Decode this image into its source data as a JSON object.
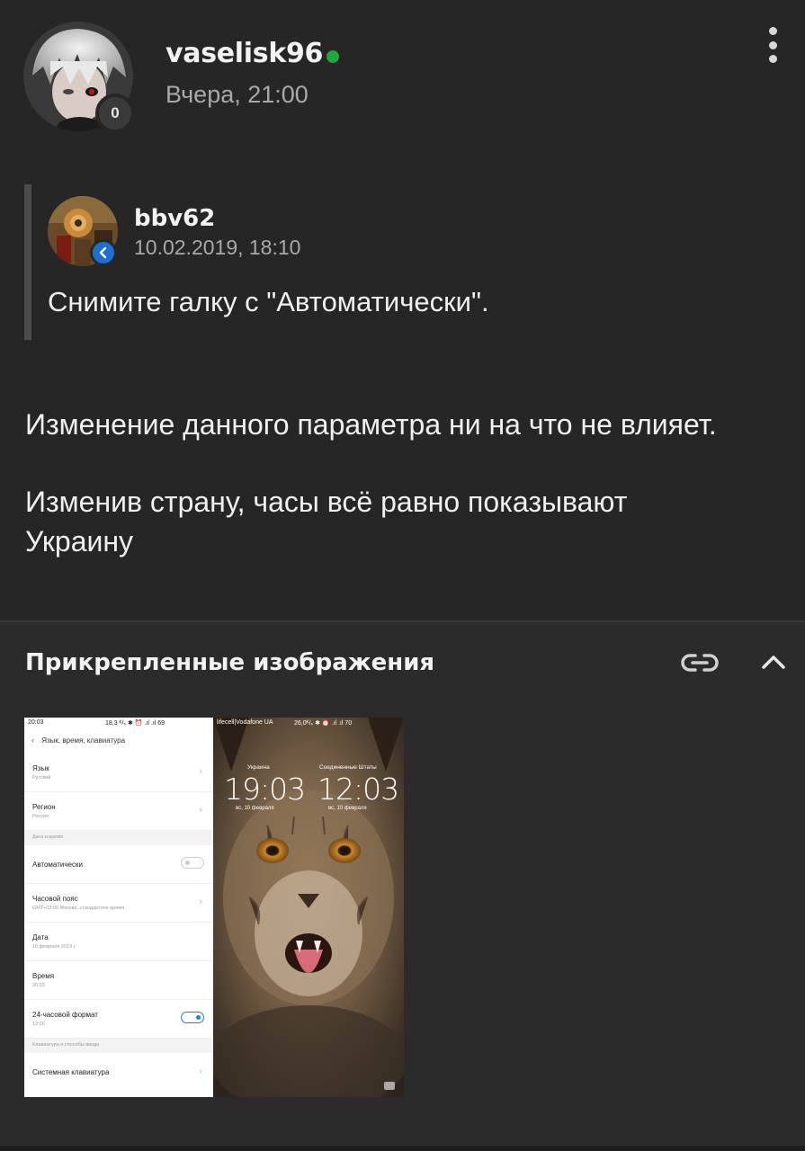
{
  "author": {
    "username": "vaselisk96",
    "reputation": "0",
    "date": "Вчера, 21:00",
    "online_color": "#1fa83a"
  },
  "quote": {
    "author": "bbv62",
    "date": "10.02.2019, 18:10",
    "text": "Снимите галку с \"Автоматически\"."
  },
  "body": {
    "paragraph1": "Изменение данного параметра ни на что не влияет.",
    "paragraph2_line1": "Изменив страну, часы всё равно показывают",
    "paragraph2_line2": "Украину"
  },
  "attachments": {
    "title": "Прикрепленные изображения",
    "link_icon": "link-icon",
    "collapse_icon": "chevron-up-icon"
  },
  "screenshot_left": {
    "status_time": "20:03",
    "status_right": "18,3 ᴷ/ₛ ✱ ⏰ .ıl .ıl 69",
    "header": "Язык, время, клавиатура",
    "rows": [
      {
        "label": "Язык",
        "sub": "Русский"
      },
      {
        "label": "Регион",
        "sub": "Россия"
      }
    ],
    "section_datetime": "Дата и время",
    "auto_label": "Автоматически",
    "timezone_label": "Часовой пояс",
    "timezone_sub": "GMT+03:00 Москва, стандартное время",
    "date_label": "Дата",
    "date_sub": "10 февраля 2019 г.",
    "time_label": "Время",
    "time_sub": "20:03",
    "format_label": "24-часовой формат",
    "format_sub": "13:00",
    "section_keyboard": "Клавиатура и способы ввода",
    "keyboard_label": "Системная клавиатура",
    "accent": "#1e7be0"
  },
  "screenshot_right": {
    "status_left": "lifecell|Vodafone UA",
    "status_right": "26,0ᴷ/ₛ ✱ ⏰ .ıl .ıl 70",
    "clock1_label": "Украина",
    "clock1_time": "19:03",
    "clock1_date": "вс, 10 февраля",
    "clock2_label": "Соединенные Штаты",
    "clock2_time": "12:03",
    "clock2_date": "вс, 10 февраля"
  }
}
